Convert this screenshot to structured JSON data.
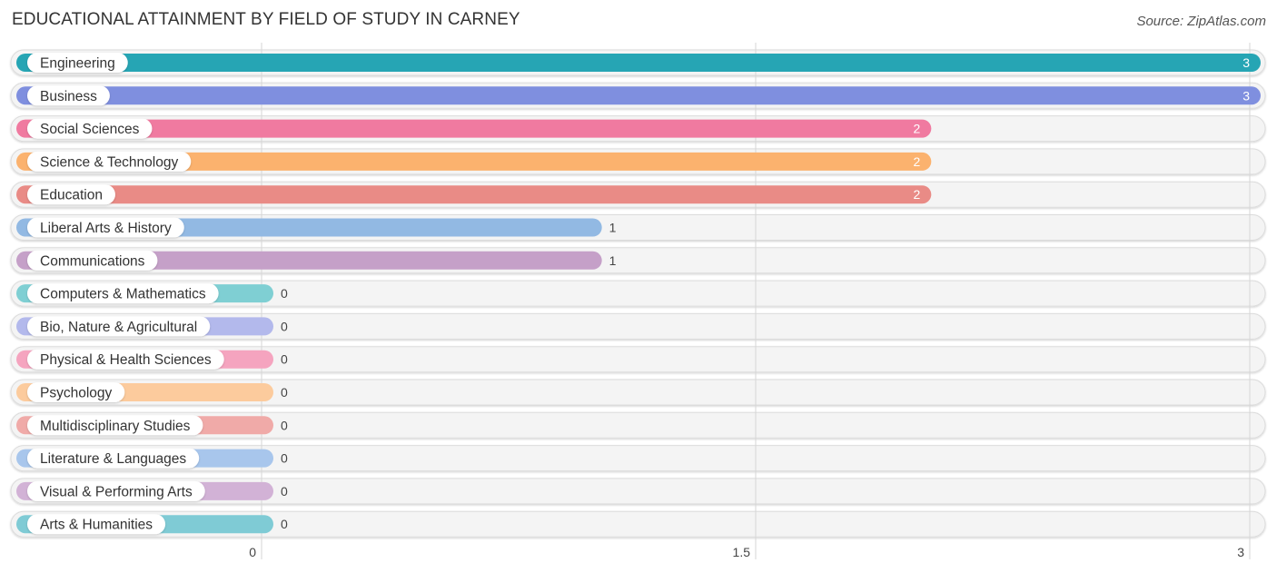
{
  "header": {
    "title": "EDUCATIONAL ATTAINMENT BY FIELD OF STUDY IN CARNEY",
    "source": "Source: ZipAtlas.com"
  },
  "chart_data": {
    "type": "bar",
    "orientation": "horizontal",
    "title": "EDUCATIONAL ATTAINMENT BY FIELD OF STUDY IN CARNEY",
    "xlabel": "",
    "ylabel": "",
    "xlim": [
      0,
      3
    ],
    "xticks": [
      0,
      1.5,
      3
    ],
    "xtick_labels": [
      "0",
      "1.5",
      "3"
    ],
    "grid": true,
    "categories": [
      "Engineering",
      "Business",
      "Social Sciences",
      "Science & Technology",
      "Education",
      "Liberal Arts & History",
      "Communications",
      "Computers & Mathematics",
      "Bio, Nature & Agricultural",
      "Physical & Health Sciences",
      "Psychology",
      "Multidisciplinary Studies",
      "Literature & Languages",
      "Visual & Performing Arts",
      "Arts & Humanities"
    ],
    "values": [
      3,
      3,
      2,
      2,
      2,
      1,
      1,
      0,
      0,
      0,
      0,
      0,
      0,
      0,
      0
    ],
    "value_labels": [
      "3",
      "3",
      "2",
      "2",
      "2",
      "1",
      "1",
      "0",
      "0",
      "0",
      "0",
      "0",
      "0",
      "0",
      "0"
    ],
    "colors": [
      "#26a5b4",
      "#7f8fdf",
      "#f07aa0",
      "#fbb26e",
      "#e98b86",
      "#92b9e3",
      "#c5a0c8",
      "#7fcfd3",
      "#b3b9ec",
      "#f5a4bf",
      "#fccb9d",
      "#f0aaa8",
      "#a8c6ec",
      "#d2b2d6",
      "#7fcbd5"
    ]
  }
}
